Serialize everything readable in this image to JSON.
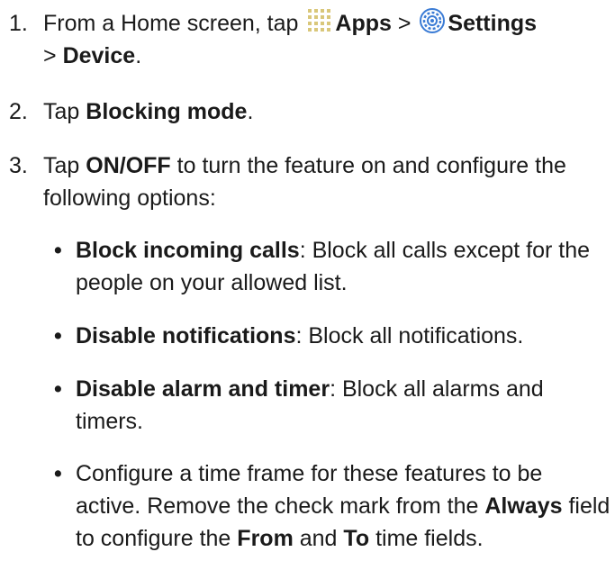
{
  "steps": [
    {
      "number": "1.",
      "pre": "From a Home screen, tap",
      "apps_label": "Apps",
      "sep": ">",
      "settings_label": "Settings",
      "sep2": ">",
      "device_label": "Device",
      "end": "."
    },
    {
      "number": "2.",
      "pre": "Tap",
      "bold": "Blocking mode",
      "end": "."
    },
    {
      "number": "3.",
      "pre": "Tap",
      "bold": "ON/OFF",
      "rest": "to turn the feature on and configure the following options:"
    }
  ],
  "bullets": [
    {
      "bold": "Block incoming calls",
      "rest": ": Block all calls except for the people on your allowed list."
    },
    {
      "bold": "Disable notifications",
      "rest": ": Block all notifications."
    },
    {
      "bold": "Disable alarm and timer",
      "rest": ": Block all alarms and timers."
    },
    {
      "text1": "Configure a time frame for these features to be active. Remove the check mark from the",
      "always": "Always",
      "text2": "field to configure the",
      "from": "From",
      "and": "and",
      "to": "To",
      "text3": "time fields."
    }
  ],
  "icons": {
    "apps": "apps-grid-icon",
    "settings": "settings-gear-icon"
  },
  "colors": {
    "text": "#1a1a1a",
    "apps_icon": "#d9c77a",
    "settings_icon": "#3a7bd5"
  }
}
